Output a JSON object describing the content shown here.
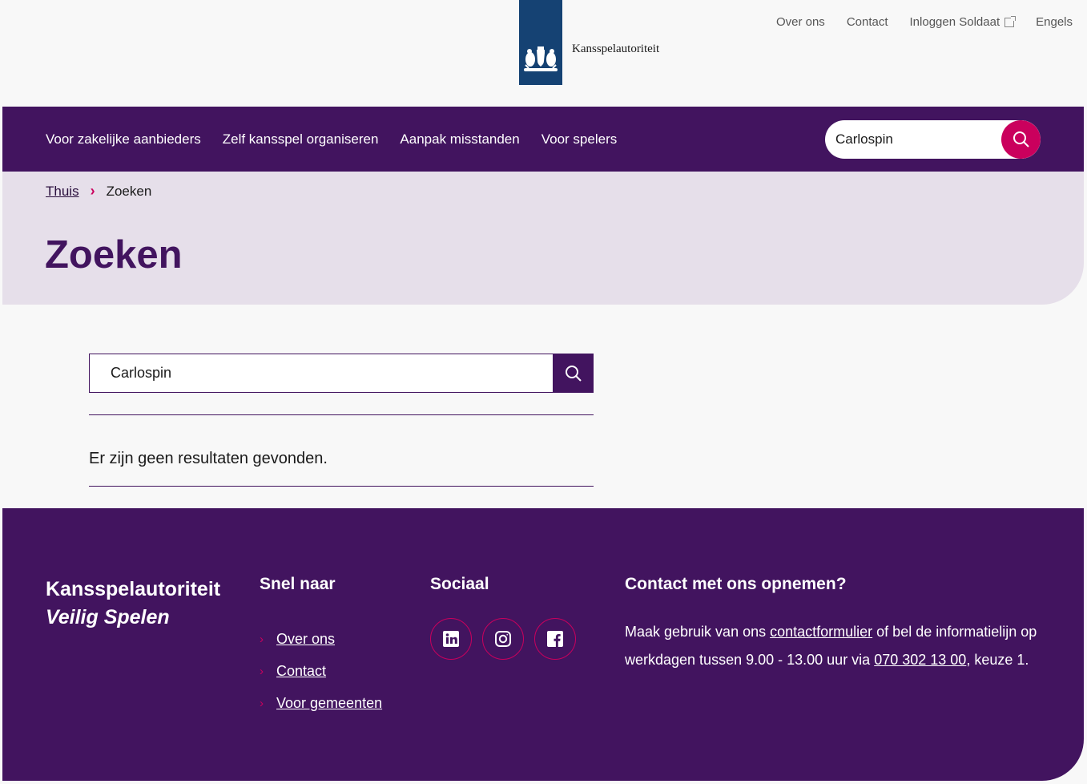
{
  "header": {
    "logo_text": "Kansspelautoriteit",
    "service_links": [
      {
        "label": "Over ons"
      },
      {
        "label": "Contact"
      },
      {
        "label": "Inloggen Soldaat",
        "icon": "external-link-icon"
      },
      {
        "label": "Engels"
      }
    ]
  },
  "nav": {
    "items": [
      "Voor zakelijke aanbieders",
      "Zelf kansspel organiseren",
      "Aanpak misstanden",
      "Voor spelers"
    ],
    "search_value": "Carlospin",
    "search_icon": "search-icon"
  },
  "breadcrumb": {
    "home": "Thuis",
    "current": "Zoeken"
  },
  "page": {
    "title": "Zoeken",
    "search_value": "Carlospin",
    "no_results": "Er zijn geen resultaten gevonden."
  },
  "footer": {
    "brand_name": "Kansspelautoriteit",
    "brand_slogan": "Veilig Spelen",
    "quick_title": "Snel naar",
    "quick_links": [
      "Over ons",
      "Contact",
      "Voor gemeenten"
    ],
    "social_title": "Sociaal",
    "social_icons": [
      "linkedin-icon",
      "instagram-icon",
      "facebook-icon"
    ],
    "contact_title": "Contact met ons opnemen?",
    "contact_text_1": "Maak gebruik van ons ",
    "contact_link": "contactformulier",
    "contact_text_2": " of bel de informatielijn op werkdagen tussen 9.00 - 13.00 uur via ",
    "contact_phone": "070 302 13 00",
    "contact_text_3": ", keuze 1."
  },
  "colors": {
    "brand_purple": "#42145f",
    "accent_pink": "#ca005d",
    "hero_lilac": "#e6dfea",
    "rijksoverheid_blue": "#154273"
  }
}
